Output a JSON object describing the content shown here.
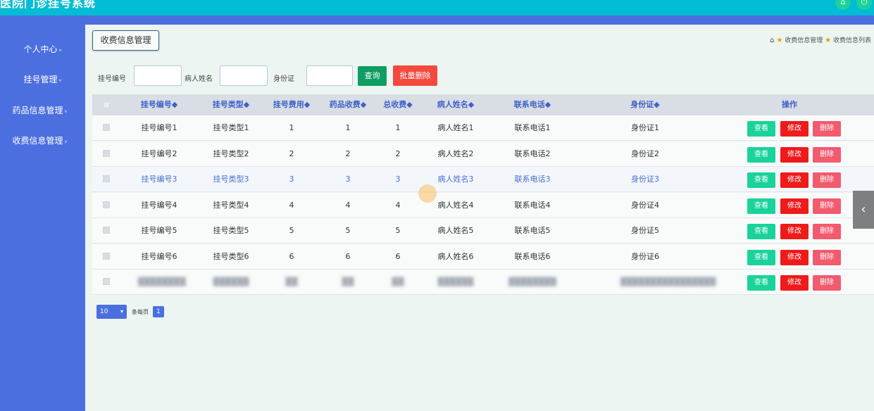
{
  "app": {
    "title": "医院门诊挂号系统"
  },
  "sidebar": {
    "items": [
      {
        "label": "个人中心"
      },
      {
        "label": "挂号管理"
      },
      {
        "label": "药品信息管理"
      },
      {
        "label": "收费信息管理"
      }
    ]
  },
  "page": {
    "title_button": "收费信息管理",
    "breadcrumb": [
      "收费信息管理",
      "收费信息列表"
    ]
  },
  "search": {
    "fields": [
      {
        "label": "挂号编号",
        "value": ""
      },
      {
        "label": "病人姓名",
        "value": ""
      },
      {
        "label": "身份证",
        "value": ""
      }
    ],
    "search_label": "查询",
    "batch_delete_label": "批量删除"
  },
  "table": {
    "columns": [
      "挂号编号",
      "挂号类型",
      "挂号费用",
      "药品收费",
      "总收费",
      "病人姓名",
      "联系电话",
      "身份证",
      "操作"
    ],
    "sort_mark": "◆",
    "rows": [
      [
        "挂号编号1",
        "挂号类型1",
        "1",
        "1",
        "1",
        "病人姓名1",
        "联系电话1",
        "身份证1"
      ],
      [
        "挂号编号2",
        "挂号类型2",
        "2",
        "2",
        "2",
        "病人姓名2",
        "联系电话2",
        "身份证2"
      ],
      [
        "挂号编号3",
        "挂号类型3",
        "3",
        "3",
        "3",
        "病人姓名3",
        "联系电话3",
        "身份证3"
      ],
      [
        "挂号编号4",
        "挂号类型4",
        "4",
        "4",
        "4",
        "病人姓名4",
        "联系电话4",
        "身份证4"
      ],
      [
        "挂号编号5",
        "挂号类型5",
        "5",
        "5",
        "5",
        "病人姓名5",
        "联系电话5",
        "身份证5"
      ],
      [
        "挂号编号6",
        "挂号类型6",
        "6",
        "6",
        "6",
        "病人姓名6",
        "联系电话6",
        "身份证6"
      ],
      [
        "████████",
        "██████",
        "██",
        "██",
        "██",
        "██████",
        "████████",
        "████████████████"
      ]
    ],
    "actions": {
      "view": "查看",
      "edit": "修改",
      "delete": "删除"
    },
    "highlight_row": 2
  },
  "pagination": {
    "page_size": "10",
    "per_page_label": "条每页",
    "current_page": "1"
  },
  "colors": {
    "accent": "#4c6fe0",
    "topbar": "#00bcd4",
    "view": "#19d39a",
    "edit": "#ef1b1b",
    "delete": "#f25a6e"
  }
}
